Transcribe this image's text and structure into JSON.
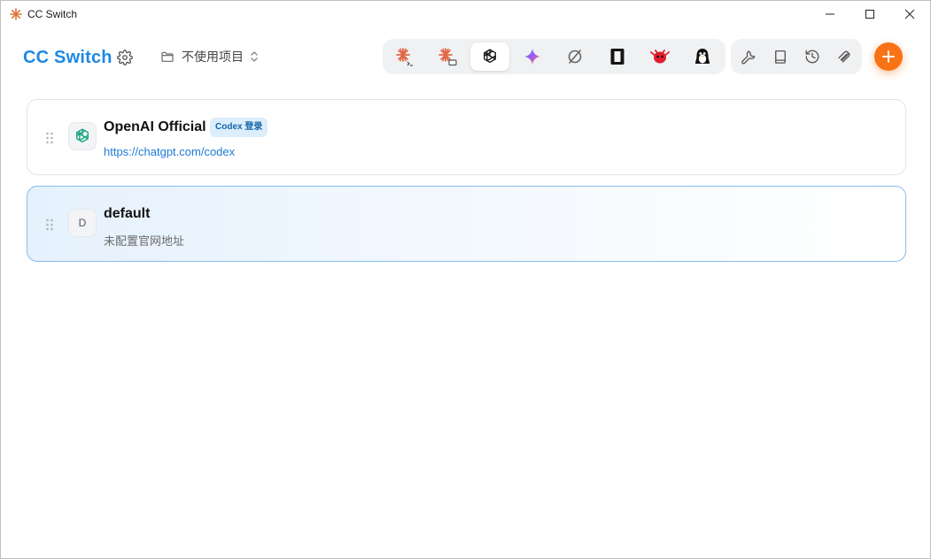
{
  "window": {
    "title": "CC Switch",
    "controls": [
      "minimize-icon",
      "maximize-icon",
      "close-icon"
    ]
  },
  "header": {
    "brand": "CC Switch",
    "settings_icon": "gear-icon",
    "project_label": "不使用项目",
    "project_icon": "folder-icon",
    "project_chevron": "chevron-updown-icon"
  },
  "app_tabs": [
    {
      "name": "claude-code-icon",
      "active": false
    },
    {
      "name": "claude-desktop-icon",
      "active": false
    },
    {
      "name": "openai-codex-icon",
      "active": true
    },
    {
      "name": "gemini-icon",
      "active": false
    },
    {
      "name": "opencode-icon",
      "active": false
    },
    {
      "name": "terminal-app-icon",
      "active": false
    },
    {
      "name": "red-mascot-icon",
      "active": false
    },
    {
      "name": "penguin-icon",
      "active": false
    }
  ],
  "tools": [
    "wrench-icon",
    "book-icon",
    "history-icon",
    "paperclip-icon"
  ],
  "add_button_icon": "plus-icon",
  "providers": [
    {
      "name": "OpenAI Official",
      "badge": "Codex 登录",
      "url": "https://chatgpt.com/codex",
      "icon": "openai-logo-icon",
      "active": false
    },
    {
      "name": "default",
      "initial": "D",
      "subtitle": "未配置官网地址",
      "active": true
    }
  ],
  "colors": {
    "brand": "#1e88e5",
    "accent_orange": "#f97316",
    "link": "#1e7ad6",
    "active_border": "#86bdf0"
  }
}
